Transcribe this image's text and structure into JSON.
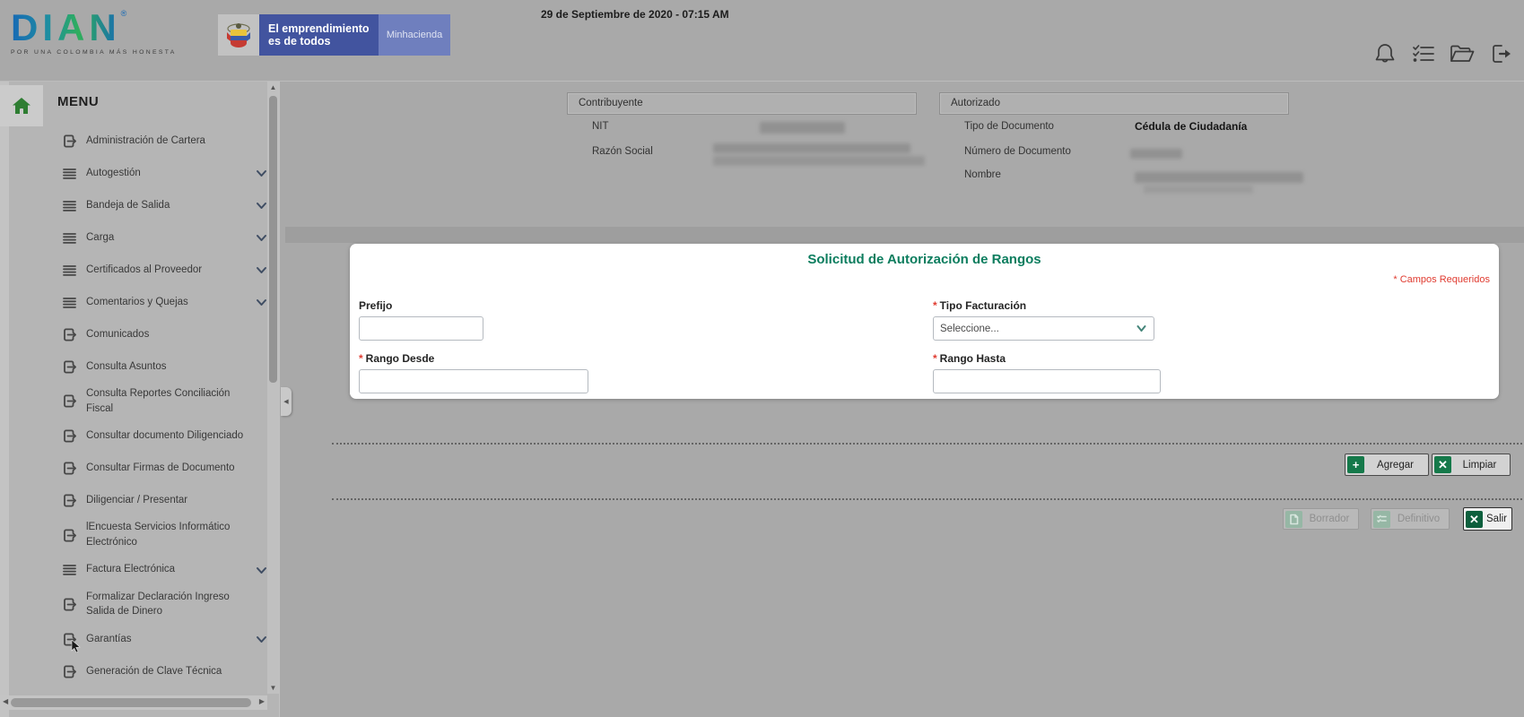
{
  "header": {
    "brand": "DIAN",
    "brand_registered": "®",
    "brand_tagline": "POR UNA COLOMBIA MÁS HONESTA",
    "banner": {
      "slogan_line1": "El emprendimiento",
      "slogan_line2": "es de todos",
      "ministry": "Minhacienda"
    },
    "datetime": "29 de Septiembre de 2020 - 07:15 AM",
    "icons": [
      {
        "name": "bell-icon"
      },
      {
        "name": "checklist-icon"
      },
      {
        "name": "folder-open-icon"
      },
      {
        "name": "logout-icon"
      }
    ]
  },
  "sidebar": {
    "menu_title": "MENU",
    "items": [
      {
        "label": "Administración de Cartera",
        "icon": "box-arrow-icon",
        "expandable": false
      },
      {
        "label": "Autogestión",
        "icon": "menu-lines-icon",
        "expandable": true
      },
      {
        "label": "Bandeja de Salida",
        "icon": "menu-lines-icon",
        "expandable": true
      },
      {
        "label": "Carga",
        "icon": "menu-lines-icon",
        "expandable": true
      },
      {
        "label": "Certificados al Proveedor",
        "icon": "menu-lines-icon",
        "expandable": true
      },
      {
        "label": "Comentarios y Quejas",
        "icon": "menu-lines-icon",
        "expandable": true
      },
      {
        "label": "Comunicados",
        "icon": "box-arrow-icon",
        "expandable": false
      },
      {
        "label": "Consulta Asuntos",
        "icon": "box-arrow-icon",
        "expandable": false
      },
      {
        "label": "Consulta Reportes Conciliación Fiscal",
        "icon": "box-arrow-icon",
        "expandable": false
      },
      {
        "label": "Consultar documento Diligenciado",
        "icon": "box-arrow-icon",
        "expandable": false
      },
      {
        "label": "Consultar Firmas de Documento",
        "icon": "box-arrow-icon",
        "expandable": false
      },
      {
        "label": "Diligenciar / Presentar",
        "icon": "box-arrow-icon",
        "expandable": false
      },
      {
        "label": "lEncuesta Servicios Informático Electrónico",
        "icon": "box-arrow-icon",
        "expandable": false
      },
      {
        "label": "Factura Electrónica",
        "icon": "menu-lines-icon",
        "expandable": true
      },
      {
        "label": "Formalizar Declaración Ingreso Salida de Dinero",
        "icon": "box-arrow-icon",
        "expandable": false
      },
      {
        "label": "Garantías",
        "icon": "box-arrow-icon",
        "expandable": true,
        "has_cursor": true
      },
      {
        "label": "Generación de Clave Técnica",
        "icon": "box-arrow-icon",
        "expandable": false
      }
    ]
  },
  "panels": {
    "contribuyente": {
      "title": "Contribuyente",
      "nit_label": "NIT",
      "razon_label": "Razón Social"
    },
    "autorizado": {
      "title": "Autorizado",
      "tipo_label": "Tipo de Documento",
      "tipo_value": "Cédula de Ciudadanía",
      "numero_label": "Número de Documento",
      "nombre_label": "Nombre"
    }
  },
  "form": {
    "title": "Solicitud de Autorización de Rangos",
    "required_note": "* Campos Requeridos",
    "required_mark": "*",
    "prefijo_label": "Prefijo",
    "tipo_facturacion_label": "Tipo Facturación",
    "tipo_facturacion_value": "Seleccione...",
    "rango_desde_label": "Rango Desde",
    "rango_hasta_label": "Rango Hasta"
  },
  "actions": {
    "agregar": "Agregar",
    "limpiar": "Limpiar",
    "borrador": "Borrador",
    "definitivo": "Definitivo",
    "salir": "Salir"
  },
  "colors": {
    "page_bg": "#a9a9a9",
    "title_green": "#0c7d5e",
    "button_green": "#15794a",
    "salir_green": "#0d5f3d",
    "required_red": "#e03b30",
    "banner_blue": "#42549f",
    "banner_blue_light": "#6f7fbe",
    "home_green": "#2e7d32"
  }
}
